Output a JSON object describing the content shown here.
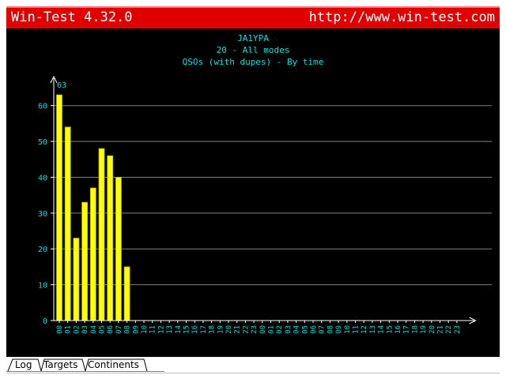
{
  "window": {
    "app_title": "Win-Test 4.32.0",
    "url": "http://www.win-test.com"
  },
  "tabs": [
    {
      "label": "Log"
    },
    {
      "label": "Targets"
    },
    {
      "label": "Continents"
    }
  ],
  "chart_data": {
    "type": "bar",
    "title": "JA1YPA",
    "subtitle": "20 - All modes",
    "subtitle2": "QSOs (with dupes) - By time",
    "categories": [
      "00",
      "01",
      "02",
      "03",
      "04",
      "05",
      "06",
      "07",
      "08",
      "09",
      "10",
      "11",
      "12",
      "13",
      "14",
      "15",
      "16",
      "17",
      "18",
      "19",
      "20",
      "21",
      "22",
      "23",
      "00",
      "01",
      "02",
      "03",
      "04",
      "05",
      "06",
      "07",
      "08",
      "09",
      "10",
      "11",
      "12",
      "13",
      "14",
      "15",
      "16",
      "17",
      "18",
      "19",
      "20",
      "21",
      "22",
      "23"
    ],
    "values": [
      63,
      54,
      23,
      33,
      37,
      48,
      46,
      40,
      15
    ],
    "max_label": "63",
    "ylim": [
      0,
      65
    ],
    "yticks": [
      0,
      10,
      20,
      30,
      40,
      50,
      60
    ],
    "grid": true,
    "colors": {
      "bar": "#ffff00",
      "bar_outline": "#b0b000",
      "text": "#00e0e0",
      "axis": "#ffffff",
      "grid": "#808080",
      "background": "#000000"
    }
  }
}
